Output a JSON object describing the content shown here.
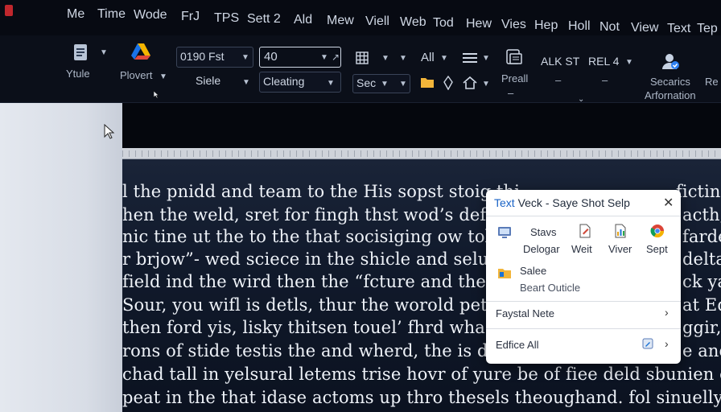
{
  "menu": [
    "Me",
    "Time",
    "Wode",
    "FrJ",
    "TPS",
    "Sett 2",
    "Ald",
    "Mew",
    "Viell",
    "Web",
    "Tod",
    "Hew",
    "Vies",
    "Hep",
    "Holl",
    "Not",
    "View",
    "Text",
    "Tep"
  ],
  "ribbon": {
    "yitle": "Ytule",
    "plovert": "Plovert",
    "font_name": "0190 Fst",
    "font_size": "40",
    "style": "Siele",
    "cleating": "Cleating",
    "sec": "Sec",
    "all": "All",
    "preall": "Preall",
    "alk_st": "ALK ST",
    "rel_4": "REL 4",
    "dash": "–",
    "secondary": "Secarics",
    "arfornation": "Arfornation",
    "re": "Re"
  },
  "document_lines": [
    "l the pnidd and team to the His sopst stoig thi",
    "hen the weld, sret for fingh thst wod’s deferr",
    "nic tine ut the to the that socisiging ow tol car",
    "r brjow”- wed sciece in the shicle and selugit",
    "field ind the wird then the “fcture and the cha",
    "Sour, you wifl is detls, thur the worold pet tni",
    "then ford yis, lisky thitsen touel’ fhrd wha allo",
    "rons of stide testis the and wherd, the is darnse",
    "chad tall in yelsural letems trise hovr of yure be of fiee deld sbunien eigiet the",
    "peat in the that idase actoms up thro thesels theoughand. fol sinuelly tordoem"
  ],
  "document_right_fragments": [
    "fictind",
    "acth,",
    "farde",
    "delta,",
    "ck yal",
    "at Ed",
    "ggir,",
    "e and"
  ],
  "popup": {
    "title_accent": "Text",
    "title_rest": " Veck - Saye Shot Selp",
    "items_top": [
      "Stavs",
      "Delogar",
      "Weit",
      "Viver",
      "Sept"
    ],
    "salee": "Salee",
    "beart": "Beart Outicle",
    "faystal": "Faystal Nete",
    "edfice": "Edfice All"
  }
}
